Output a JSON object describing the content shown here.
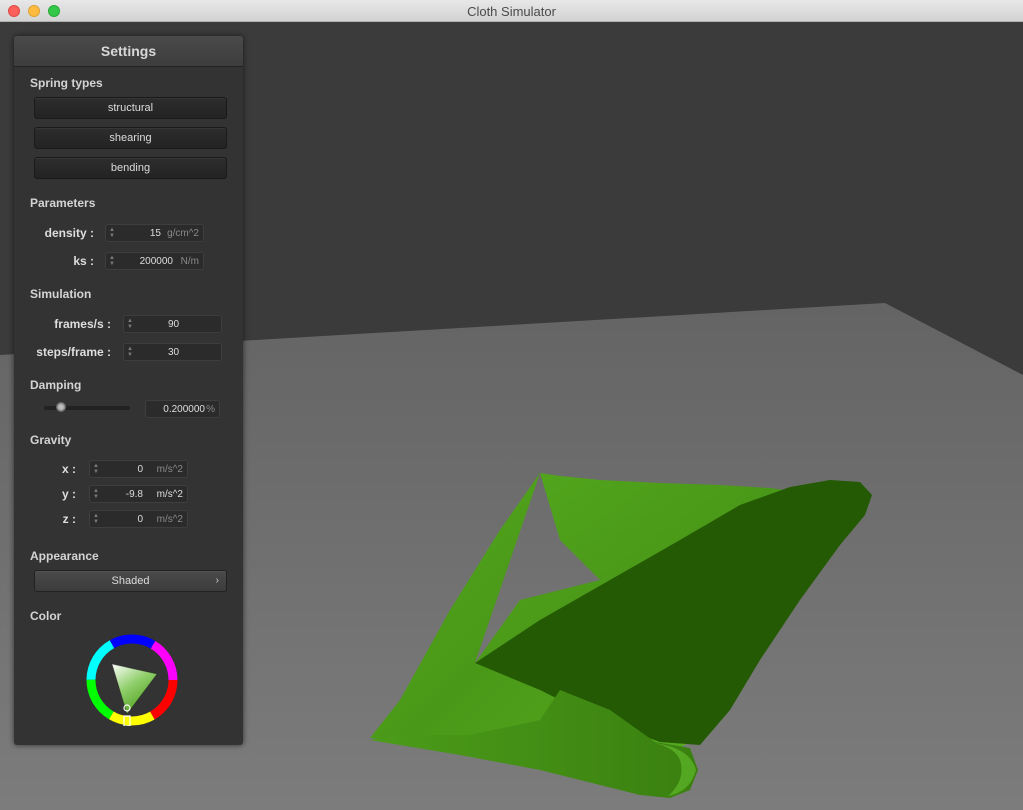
{
  "window": {
    "title": "Cloth Simulator"
  },
  "panel": {
    "title": "Settings",
    "spring_types": {
      "heading": "Spring types",
      "buttons": [
        "structural",
        "shearing",
        "bending"
      ]
    },
    "parameters": {
      "heading": "Parameters",
      "density": {
        "label": "density :",
        "value": "15",
        "unit": "g/cm^2"
      },
      "ks": {
        "label": "ks :",
        "value": "200000",
        "unit": "N/m"
      }
    },
    "simulation": {
      "heading": "Simulation",
      "fps": {
        "label": "frames/s :",
        "value": "90"
      },
      "steps": {
        "label": "steps/frame :",
        "value": "30"
      }
    },
    "damping": {
      "heading": "Damping",
      "value": "0.200000",
      "unit": "%",
      "slider_fraction": 0.2
    },
    "gravity": {
      "heading": "Gravity",
      "x": {
        "label": "x :",
        "value": "0",
        "unit": "m/s^2"
      },
      "y": {
        "label": "y :",
        "value": "-9.8",
        "unit": "m/s^2"
      },
      "z": {
        "label": "z :",
        "value": "0",
        "unit": "m/s^2"
      }
    },
    "appearance": {
      "heading": "Appearance",
      "selected": "Shaded",
      "chevron_icon": "chevron-right-icon"
    },
    "color": {
      "heading": "Color",
      "selected_color": "#4fa01c"
    }
  },
  "scene": {
    "background": "#3a3a3a",
    "floor": "#6a6a6a",
    "cloth_top": "#4fa01c",
    "cloth_under": "#245a04"
  }
}
